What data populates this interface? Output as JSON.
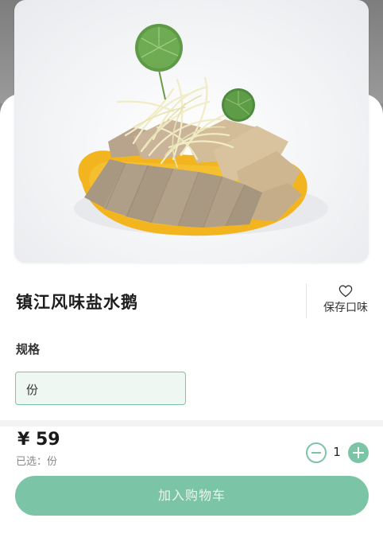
{
  "product": {
    "name": "镇江风味盐水鹅",
    "image_icon": "dish-photo"
  },
  "save_flavor": {
    "label": "保存口味",
    "icon": "heart-outline-icon"
  },
  "spec": {
    "label": "规格",
    "options": [
      "份"
    ],
    "selected": "份"
  },
  "footer": {
    "price": "¥ 59",
    "selected_text": "已选：份",
    "quantity": "1",
    "add_to_cart_label": "加入购物车"
  },
  "colors": {
    "accent": "#7cc4a6",
    "accent_light": "#eef7f2",
    "sauce": "#f2b51f"
  }
}
